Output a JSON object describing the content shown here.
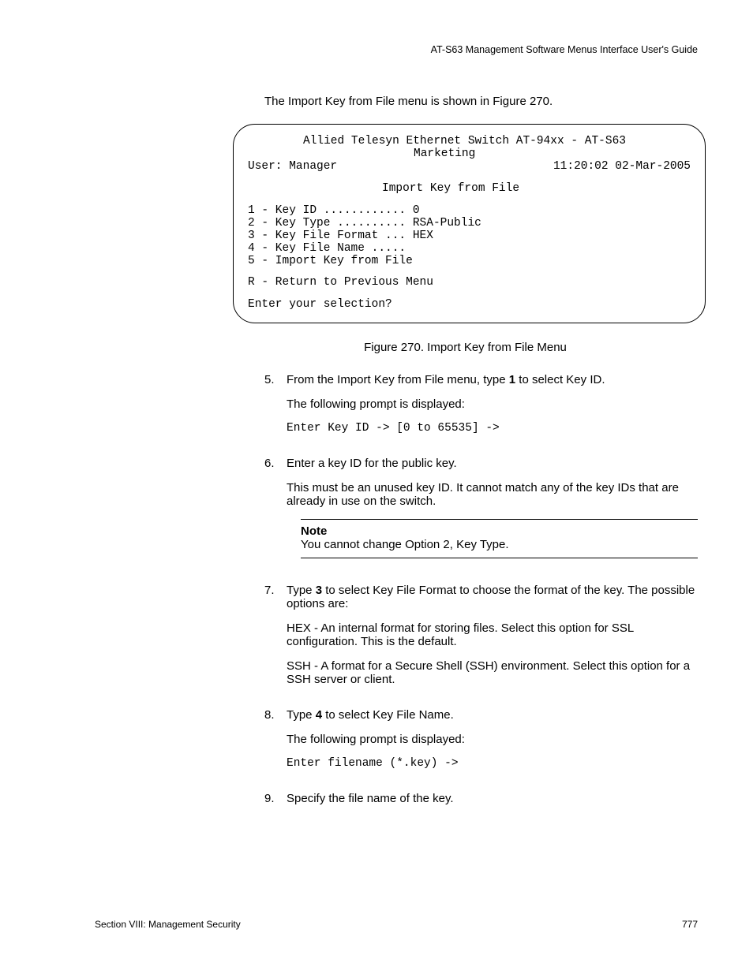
{
  "header": "AT-S63 Management Software Menus Interface User's Guide",
  "intro": "The Import Key from File menu is shown in Figure 270.",
  "terminal": {
    "line1": "Allied Telesyn Ethernet Switch AT-94xx - AT-S63",
    "line2": "Marketing",
    "user_left": "User: Manager",
    "user_right": "11:20:02 02-Mar-2005",
    "title": "Import Key from File",
    "m1": "1 - Key ID ............ 0",
    "m2": "2 - Key Type .......... RSA-Public",
    "m3": "3 - Key File Format ... HEX",
    "m4": "4 - Key File Name .....",
    "m5": "5 - Import Key from File",
    "ret": "R - Return to Previous Menu",
    "prompt": "Enter your selection?"
  },
  "figcaption": "Figure 270. Import Key from File Menu",
  "step5": {
    "num": "5.",
    "pre": "From the Import Key from File menu, type ",
    "bold": "1",
    "post": " to select Key ID.",
    "p2": "The following prompt is displayed:",
    "code": "Enter Key ID -> [0 to 65535] ->"
  },
  "step6": {
    "num": "6.",
    "p1": "Enter a key ID for the public key.",
    "p2": "This must be an unused key ID. It cannot match any of the key IDs that are already in use on the switch."
  },
  "note": {
    "title": "Note",
    "body": "You cannot change Option 2, Key Type."
  },
  "step7": {
    "num": "7.",
    "pre": "Type ",
    "bold": "3",
    "post": " to select Key File Format to choose the format of the key. The possible options are:",
    "p2": "HEX - An internal format for storing files. Select this option for SSL configuration. This is the default.",
    "p3": "SSH - A format for a Secure Shell (SSH) environment. Select this option for a SSH server or client."
  },
  "step8": {
    "num": "8.",
    "pre": "Type ",
    "bold": "4",
    "post": " to select Key File Name.",
    "p2": "The following prompt is displayed:",
    "code": "Enter filename (*.key) ->"
  },
  "step9": {
    "num": "9.",
    "p1": "Specify the file name of the key."
  },
  "footer": {
    "left": "Section VIII: Management Security",
    "right": "777"
  }
}
